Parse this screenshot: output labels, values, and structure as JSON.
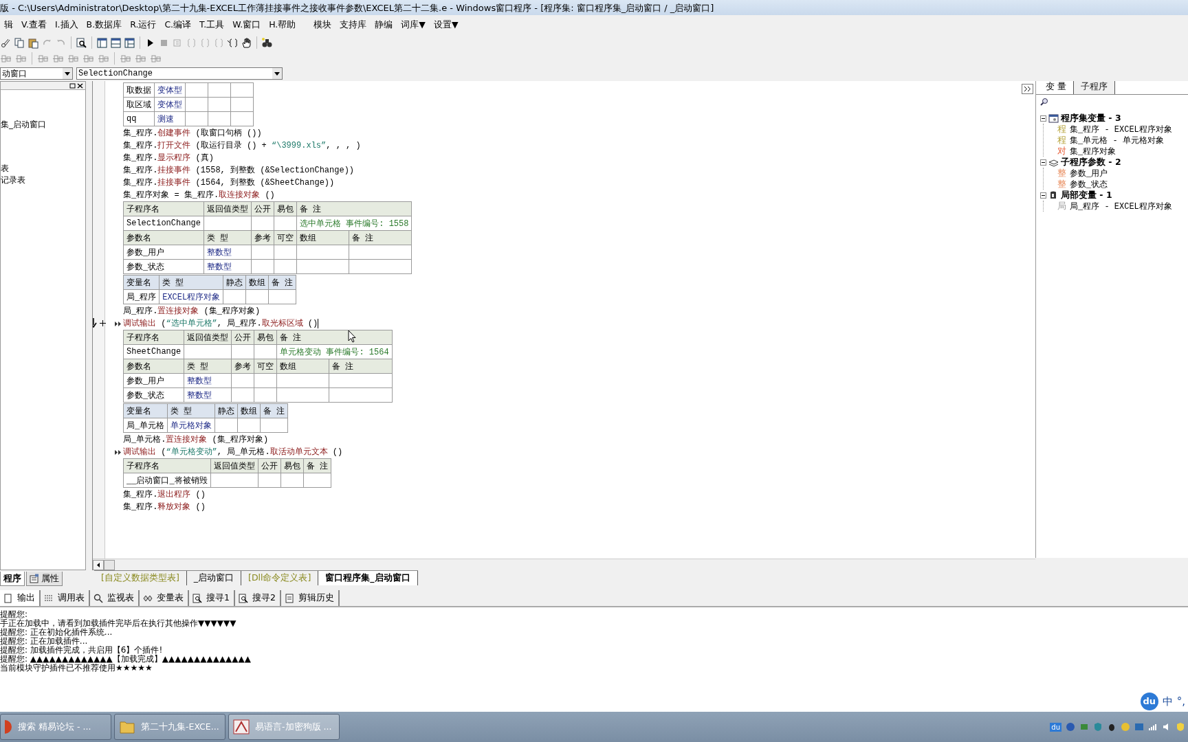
{
  "window": {
    "title": "版 - C:\\Users\\Administrator\\Desktop\\第二十九集-EXCEL工作薄挂接事件之接收事件参数\\EXCEL第二十二集.e - Windows窗口程序 - [程序集: 窗口程序集_启动窗口 / _启动窗口]"
  },
  "menu": [
    "辑",
    "V.查看",
    "I.插入",
    "B.数据库",
    "R.运行",
    "C.编译",
    "T.工具",
    "W.窗口",
    "H.帮助",
    "模块",
    "支持库",
    "静编",
    "词库▼",
    "设置▼"
  ],
  "selectors": {
    "object": "动窗口",
    "event": "SelectionChange"
  },
  "left_panel": {
    "items": [
      "集_启动窗口",
      "表",
      "记录表"
    ],
    "tabs": [
      {
        "label": "程序",
        "selected": true
      },
      {
        "label": "属性",
        "selected": false
      }
    ]
  },
  "code": {
    "blocks": [
      {
        "kind": "var_table",
        "rows": [
          {
            "kind": "data",
            "cells": [
              "取数据",
              "变体型",
              null,
              null,
              null
            ]
          },
          {
            "kind": "data",
            "cells": [
              "取区域",
              "变体型",
              null,
              null,
              null
            ]
          },
          {
            "kind": "data",
            "cells": [
              "qq",
              "测速",
              null,
              null,
              null
            ]
          }
        ]
      },
      {
        "kind": "line",
        "current": false,
        "debug_mark": false,
        "caret": false,
        "segments": [
          {
            "text": "集_程序.",
            "kind": "plain"
          },
          {
            "text": "创建事件",
            "kind": "method"
          },
          {
            "text": " (取窗口句柄 ())",
            "kind": "plain"
          }
        ]
      },
      {
        "kind": "line",
        "current": false,
        "debug_mark": false,
        "caret": false,
        "segments": [
          {
            "text": "集_程序.",
            "kind": "plain"
          },
          {
            "text": "打开文件",
            "kind": "method"
          },
          {
            "text": " (取运行目录 () + ",
            "kind": "plain"
          },
          {
            "text": "“\\3999.xls”",
            "kind": "string"
          },
          {
            "text": ", , , )",
            "kind": "plain"
          }
        ]
      },
      {
        "kind": "line",
        "current": false,
        "debug_mark": false,
        "caret": false,
        "segments": [
          {
            "text": "集_程序.",
            "kind": "plain"
          },
          {
            "text": "显示程序",
            "kind": "method"
          },
          {
            "text": " (真)",
            "kind": "plain"
          }
        ]
      },
      {
        "kind": "line",
        "current": false,
        "debug_mark": false,
        "caret": false,
        "segments": [
          {
            "text": "集_程序.",
            "kind": "plain"
          },
          {
            "text": "挂接事件",
            "kind": "method"
          },
          {
            "text": " (1558, 到整数 (&SelectionChange))",
            "kind": "plain"
          }
        ]
      },
      {
        "kind": "line",
        "current": false,
        "debug_mark": false,
        "caret": false,
        "segments": [
          {
            "text": "集_程序.",
            "kind": "plain"
          },
          {
            "text": "挂接事件",
            "kind": "method"
          },
          {
            "text": " (1564, 到整数 (&SheetChange))",
            "kind": "plain"
          }
        ]
      },
      {
        "kind": "line",
        "current": false,
        "debug_mark": false,
        "caret": false,
        "segments": [
          {
            "text": "集_程序对象 = 集_程序.",
            "kind": "plain"
          },
          {
            "text": "取连接对象",
            "kind": "method"
          },
          {
            "text": " ()",
            "kind": "plain"
          }
        ]
      },
      {
        "kind": "sub_table",
        "rows": [
          {
            "kind": "head",
            "cells": [
              "子程序名",
              "返回值类型",
              "公开",
              "易包",
              {
                "text": "备 注",
                "colspan": 2
              }
            ]
          },
          {
            "kind": "data",
            "cells": [
              "SelectionChange",
              null,
              null,
              null,
              {
                "text": "选中单元格 事件编号: 1558",
                "colspan": 2
              }
            ]
          },
          {
            "kind": "head",
            "cells": [
              "参数名",
              "类 型",
              "参考",
              "可空",
              "数组",
              "备 注"
            ]
          },
          {
            "kind": "data",
            "cells": [
              "参数_用户",
              "整数型",
              null,
              null,
              null,
              null
            ]
          },
          {
            "kind": "data",
            "cells": [
              "参数_状态",
              "整数型",
              null,
              null,
              null,
              null
            ]
          }
        ]
      },
      {
        "kind": "var_table",
        "rows": [
          {
            "kind": "head",
            "cells": [
              "变量名",
              "类 型",
              "静态",
              "数组",
              "备 注"
            ]
          },
          {
            "kind": "data",
            "cells": [
              "局_程序",
              "EXCEL程序对象",
              null,
              null,
              null
            ]
          }
        ]
      },
      {
        "kind": "line",
        "current": false,
        "debug_mark": false,
        "caret": false,
        "segments": [
          {
            "text": "局_程序.",
            "kind": "plain"
          },
          {
            "text": "置连接对象",
            "kind": "method"
          },
          {
            "text": " (集_程序对象)",
            "kind": "plain"
          }
        ]
      },
      {
        "kind": "line",
        "current": true,
        "debug_mark": true,
        "caret": true,
        "segments": [
          {
            "text": "调试输出",
            "kind": "method"
          },
          {
            "text": " (",
            "kind": "plain"
          },
          {
            "text": "“选中单元格”",
            "kind": "string"
          },
          {
            "text": ", 局_程序.",
            "kind": "plain"
          },
          {
            "text": "取光标区域",
            "kind": "method"
          },
          {
            "text": " ()",
            "kind": "plain"
          }
        ]
      },
      {
        "kind": "sub_table",
        "rows": [
          {
            "kind": "head",
            "cells": [
              "子程序名",
              "返回值类型",
              "公开",
              "易包",
              {
                "text": "备 注",
                "colspan": 2
              }
            ]
          },
          {
            "kind": "data",
            "cells": [
              "SheetChange",
              null,
              null,
              null,
              {
                "text": "单元格变动 事件编号: 1564",
                "colspan": 2
              }
            ]
          },
          {
            "kind": "head",
            "cells": [
              "参数名",
              "类 型",
              "参考",
              "可空",
              "数组",
              "备 注"
            ]
          },
          {
            "kind": "data",
            "cells": [
              "参数_用户",
              "整数型",
              null,
              null,
              null,
              null
            ]
          },
          {
            "kind": "data",
            "cells": [
              "参数_状态",
              "整数型",
              null,
              null,
              null,
              null
            ]
          }
        ]
      },
      {
        "kind": "var_table",
        "rows": [
          {
            "kind": "head",
            "cells": [
              "变量名",
              "类 型",
              "静态",
              "数组",
              "备 注"
            ]
          },
          {
            "kind": "data",
            "cells": [
              "局_单元格",
              "单元格对象",
              null,
              null,
              null
            ]
          }
        ]
      },
      {
        "kind": "line",
        "current": false,
        "debug_mark": false,
        "caret": false,
        "segments": [
          {
            "text": "局_单元格.",
            "kind": "plain"
          },
          {
            "text": "置连接对象",
            "kind": "method"
          },
          {
            "text": " (集_程序对象)",
            "kind": "plain"
          }
        ]
      },
      {
        "kind": "line",
        "current": false,
        "debug_mark": true,
        "caret": false,
        "segments": [
          {
            "text": "调试输出",
            "kind": "method"
          },
          {
            "text": " (",
            "kind": "plain"
          },
          {
            "text": "“单元格变动”",
            "kind": "string"
          },
          {
            "text": ", 局_单元格.",
            "kind": "plain"
          },
          {
            "text": "取活动单元文本",
            "kind": "method"
          },
          {
            "text": " ()",
            "kind": "plain"
          }
        ]
      },
      {
        "kind": "sub_table",
        "rows": [
          {
            "kind": "head",
            "cells": [
              "子程序名",
              "返回值类型",
              "公开",
              "易包",
              "备 注"
            ]
          },
          {
            "kind": "data",
            "cells": [
              "__启动窗口_将被销毁",
              null,
              null,
              null,
              null
            ]
          }
        ]
      },
      {
        "kind": "line",
        "current": false,
        "debug_mark": false,
        "caret": false,
        "segments": [
          {
            "text": "集_程序.",
            "kind": "plain"
          },
          {
            "text": "退出程序",
            "kind": "method"
          },
          {
            "text": " ()",
            "kind": "plain"
          }
        ]
      },
      {
        "kind": "line",
        "current": false,
        "debug_mark": false,
        "caret": false,
        "segments": [
          {
            "text": "集_程序.",
            "kind": "plain"
          },
          {
            "text": "释放对象",
            "kind": "method"
          },
          {
            "text": " ()",
            "kind": "plain"
          }
        ]
      }
    ]
  },
  "editor_tabs": [
    {
      "label": "[自定义数据类型表]",
      "kind": "data",
      "selected": false
    },
    {
      "label": "_启动窗口",
      "kind": "form",
      "selected": false
    },
    {
      "label": "[Dll命令定义表]",
      "kind": "data",
      "selected": false
    },
    {
      "label": "窗口程序集_启动窗口",
      "kind": "form",
      "selected": true
    }
  ],
  "right_panel": {
    "tabs": [
      {
        "label": "变 量",
        "selected": true
      },
      {
        "label": "子程序",
        "selected": false
      }
    ],
    "tree": [
      {
        "label": "程序集变量 - 3",
        "kind": "assembly",
        "expanded": true,
        "children": [
          {
            "badge": "程",
            "label": "集_程序 - EXCEL程序对象",
            "color": "#b8a640"
          },
          {
            "badge": "程",
            "label": "集_单元格 - 单元格对象",
            "color": "#b8a640"
          },
          {
            "badge": "对",
            "label": "集_程序对象",
            "color": "#e8603c"
          }
        ]
      },
      {
        "label": "子程序参数 - 2",
        "kind": "params",
        "expanded": true,
        "children": [
          {
            "badge": "整",
            "label": "参数_用户",
            "color": "#e88a5a"
          },
          {
            "badge": "整",
            "label": "参数_状态",
            "color": "#e88a5a"
          }
        ]
      },
      {
        "label": "局部变量 - 1",
        "kind": "locals",
        "expanded": true,
        "children": [
          {
            "badge": "局",
            "label": "局_程序 - EXCEL程序对象",
            "color": "#a0a0a0"
          }
        ]
      }
    ]
  },
  "output": {
    "tabs": [
      {
        "label": "输出",
        "selected": true
      },
      {
        "label": "调用表",
        "selected": false
      },
      {
        "label": "监视表",
        "selected": false
      },
      {
        "label": "变量表",
        "selected": false
      },
      {
        "label": "搜寻1",
        "selected": false
      },
      {
        "label": "搜寻2",
        "selected": false
      },
      {
        "label": "剪辑历史",
        "selected": false
      }
    ],
    "lines": [
      "提醒您:",
      "手正在加载中，请看到加载插件完毕后在执行其他操作▼▼▼▼▼▼",
      "提醒您: 正在初始化插件系统...",
      "提醒您: 正在加载插件...",
      "提醒您: 加载插件完成，共启用【6】个插件!",
      "提醒您: ▲▲▲▲▲▲▲▲▲▲▲▲▲【加载完成】▲▲▲▲▲▲▲▲▲▲▲▲▲▲",
      "当前模块守护插件已不推荐使用★★★★★"
    ]
  },
  "ime": {
    "logo": "du",
    "lang": "中",
    "punct": "°,"
  },
  "taskbar": {
    "items": [
      {
        "label": "搜索 精易论坛 - ...",
        "selected": false
      },
      {
        "label": "第二十九集-EXCE...",
        "selected": false
      },
      {
        "label": "易语言-加密狗版 ...",
        "selected": true
      }
    ],
    "tray_logo": "du"
  }
}
